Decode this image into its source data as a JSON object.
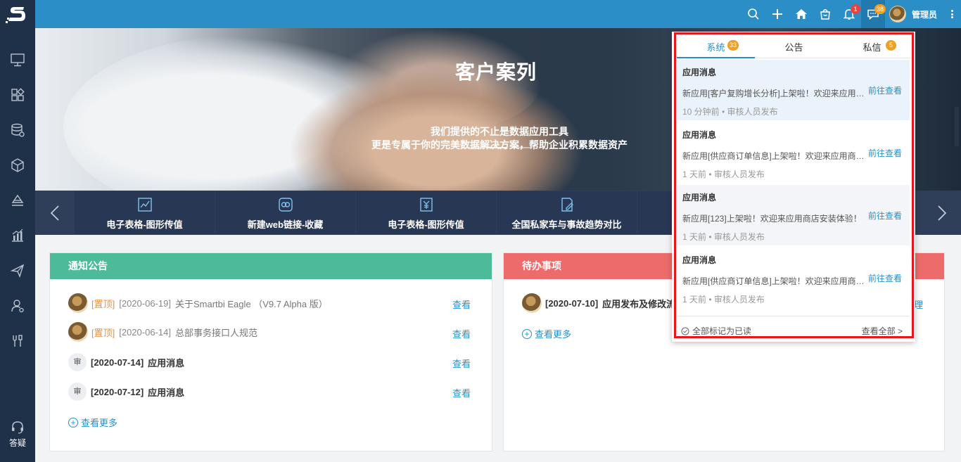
{
  "header": {
    "user_name": "管理员",
    "icons": [
      "search-icon",
      "plus-icon",
      "home-icon",
      "shop-icon",
      "bell-icon",
      "message-icon",
      "more-icon"
    ],
    "bell_badge": "1",
    "message_badge": "38"
  },
  "sidebar": {
    "items": [
      "monitor-icon",
      "apps-icon",
      "database-icon",
      "cube-icon",
      "layers-icon",
      "chart-icon",
      "send-icon",
      "user-settings-icon",
      "tools-icon"
    ],
    "help_label": "答疑"
  },
  "banner": {
    "title": "客户案列",
    "subtitle_line1": "我们提供的不止是数据应用工具",
    "subtitle_line2": "更是专属于你的完美数据解决方案，帮助企业积累数据资产"
  },
  "carousel": {
    "items": [
      {
        "label": "电子表格-图形传值",
        "icon": "chart-edit-icon"
      },
      {
        "label": "新建web链接-收藏",
        "icon": "link-icon"
      },
      {
        "label": "电子表格-图形传值",
        "icon": "yuan-icon"
      },
      {
        "label": "全国私家车与事故趋势对比",
        "icon": "edit-doc-icon"
      }
    ]
  },
  "notice": {
    "title": "通知公告",
    "rows": [
      {
        "tag": "[置顶]",
        "date": "[2020-06-19]",
        "title": "关于Smartbi Eagle （V9.7 Alpha 版）",
        "action": "查看"
      },
      {
        "tag": "[置顶]",
        "date": "[2020-06-14]",
        "title": "总部事务接口人规范",
        "action": "查看"
      },
      {
        "avatar": "审",
        "date": "[2020-07-14]",
        "title": "应用消息",
        "action": "查看"
      },
      {
        "avatar": "审",
        "date": "[2020-07-12]",
        "title": "应用消息",
        "action": "查看"
      }
    ],
    "more": "查看更多"
  },
  "todo": {
    "title": "待办事项",
    "rows": [
      {
        "date": "[2020-07-10]",
        "title": "应用发布及修改流",
        "action": "理"
      }
    ],
    "more": "查看更多"
  },
  "popup": {
    "tabs": [
      {
        "label": "系统",
        "count": "33"
      },
      {
        "label": "公告",
        "count": ""
      },
      {
        "label": "私信",
        "count": "5"
      }
    ],
    "messages": [
      {
        "title": "应用消息",
        "body": "新应用[客户复购增长分析]上架啦！欢迎来应用商店安装体验！",
        "meta": "10 分钟前 • 审核人员发布",
        "action": "前往查看"
      },
      {
        "title": "应用消息",
        "body": "新应用[供应商订单信息]上架啦！欢迎来应用商店安装体验！",
        "meta": "1 天前 • 审核人员发布",
        "action": "前往查看"
      },
      {
        "title": "应用消息",
        "body": "新应用[123]上架啦！欢迎来应用商店安装体验！",
        "meta": "1 天前 • 审核人员发布",
        "action": "前往查看"
      },
      {
        "title": "应用消息",
        "body": "新应用[供应商订单信息]上架啦！欢迎来应用商店安装体验！",
        "meta": "1 天前 • 审核人员发布",
        "action": "前往查看"
      }
    ],
    "mark_all": "全部标记为已读",
    "view_all": "查看全部 >"
  },
  "colors": {
    "topbar": "#2b8ec6",
    "sidebar": "#1f3149",
    "notice_header": "#4dba9a",
    "todo_header": "#ee6b6b",
    "link": "#2591c7",
    "highlight_box": "#e7161b"
  }
}
